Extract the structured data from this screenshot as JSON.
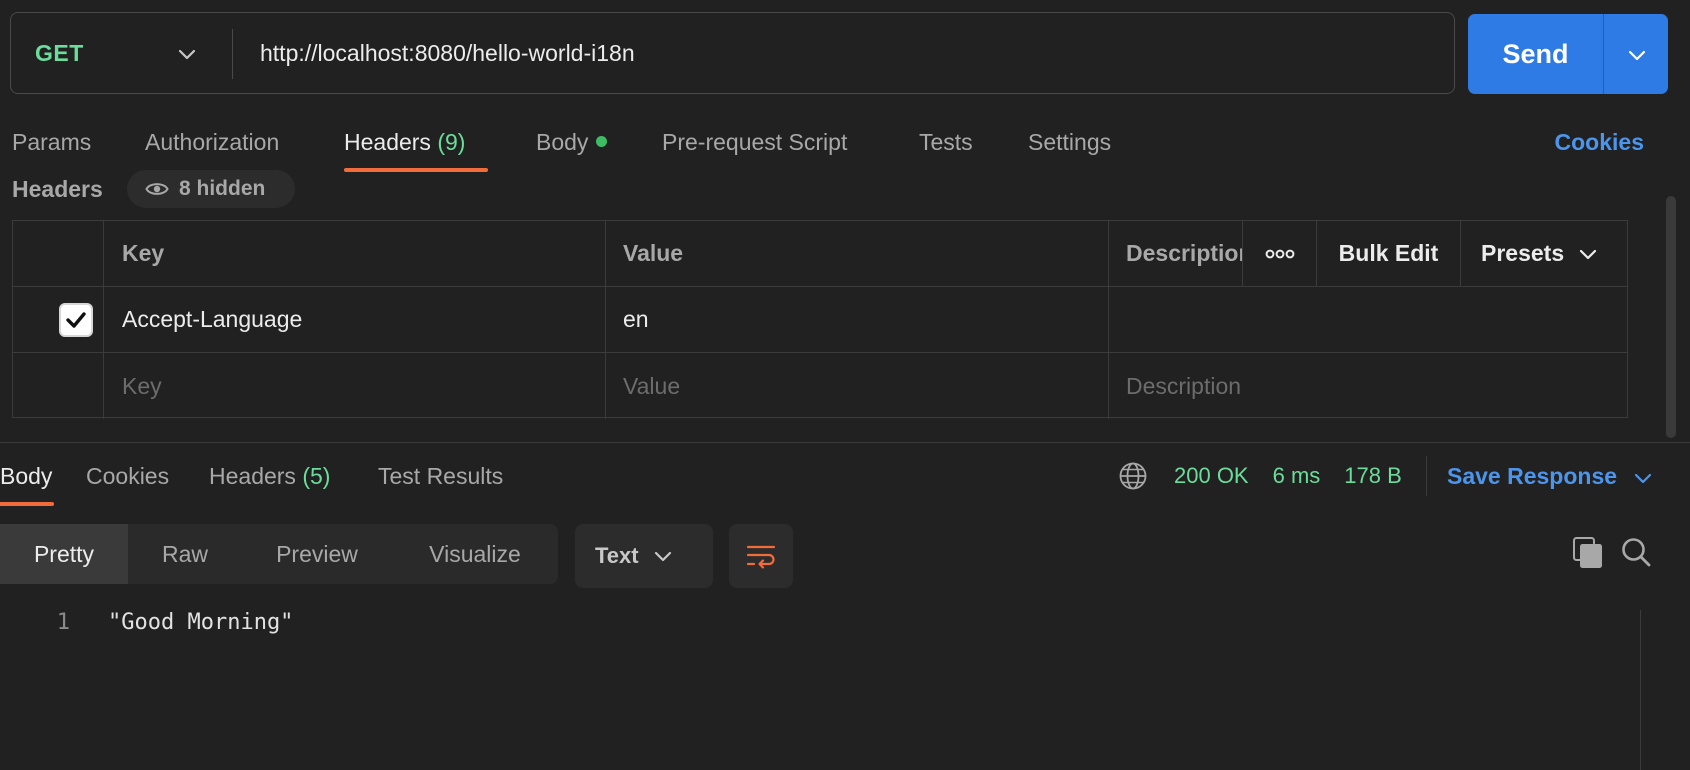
{
  "request": {
    "method": "GET",
    "url": "http://localhost:8080/hello-world-i18n",
    "send_label": "Send"
  },
  "req_tabs": {
    "params": "Params",
    "authorization": "Authorization",
    "headers": "Headers",
    "headers_count": "(9)",
    "body": "Body",
    "pre_request": "Pre-request Script",
    "tests": "Tests",
    "settings": "Settings",
    "cookies": "Cookies",
    "active": "Headers"
  },
  "headers_section": {
    "title": "Headers",
    "hidden_label": "8 hidden",
    "columns": {
      "key": "Key",
      "value": "Value",
      "description": "Description",
      "bulk_edit": "Bulk Edit",
      "presets": "Presets"
    },
    "rows": [
      {
        "checked": true,
        "key": "Accept-Language",
        "value": "en",
        "description": ""
      }
    ],
    "placeholders": {
      "key": "Key",
      "value": "Value",
      "description": "Description"
    }
  },
  "response": {
    "tabs": {
      "body": "Body",
      "cookies": "Cookies",
      "headers": "Headers",
      "headers_count": "(5)",
      "test_results": "Test Results",
      "active": "Body"
    },
    "status": "200 OK",
    "time": "6 ms",
    "size": "178 B",
    "save_label": "Save Response",
    "view_modes": [
      "Pretty",
      "Raw",
      "Preview",
      "Visualize"
    ],
    "active_view": "Pretty",
    "format": "Text",
    "lines": [
      {
        "no": "1",
        "text": "\"Good Morning\""
      }
    ]
  },
  "colors": {
    "accent_orange": "#f26b3a",
    "send_blue": "#2f7be6",
    "link_blue": "#4c95ec",
    "success_green": "#6bdd9a",
    "background": "#212121"
  }
}
